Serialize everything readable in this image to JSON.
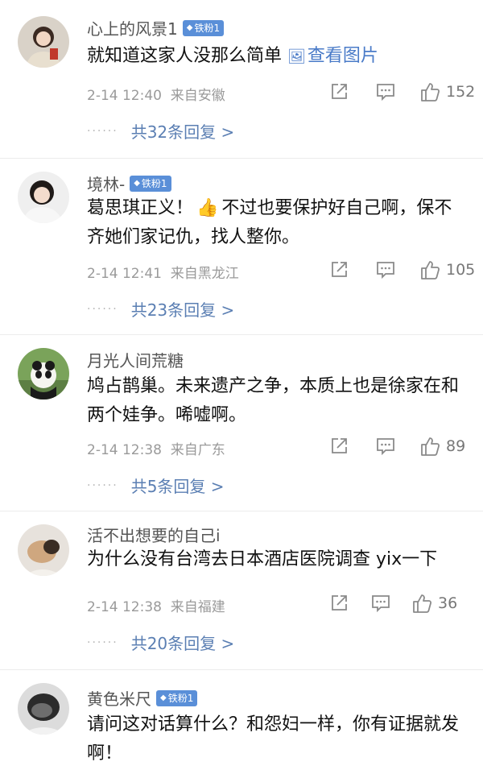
{
  "comments": [
    {
      "username": "心上的风景1",
      "badge": "铁粉1",
      "text": "就知道这家人没那么简单",
      "link_label": "查看图片",
      "time": "2-14 12:40",
      "location": "来自安徽",
      "likes": "152",
      "replies": "共32条回复 >"
    },
    {
      "username": "境林-",
      "badge": "铁粉1",
      "text_1": "葛思琪正义！",
      "emoji": "👍",
      "text_2": "不过也要保护好自己啊，保不齐她们家记仇，找人整你。",
      "time": "2-14 12:41",
      "location": "来自黑龙江",
      "likes": "105",
      "replies": "共23条回复 >"
    },
    {
      "username": "月光人间荒糖",
      "text": "鸠占鹊巢。未来遗产之争，本质上也是徐家在和两个娃争。唏嘘啊。",
      "time": "2-14 12:38",
      "location": "来自广东",
      "likes": "89",
      "replies": "共5条回复 >"
    },
    {
      "username": "活不出想要的自己i",
      "text": "为什么没有台湾去日本酒店医院调查 yix一下",
      "time": "2-14 12:38",
      "location": "来自福建",
      "likes": "36",
      "replies": "共20条回复 >"
    },
    {
      "username": "黄色米尺",
      "badge": "铁粉1",
      "text": "请问这对话算什么？和怨妇一样，你有证据就发啊！"
    }
  ]
}
